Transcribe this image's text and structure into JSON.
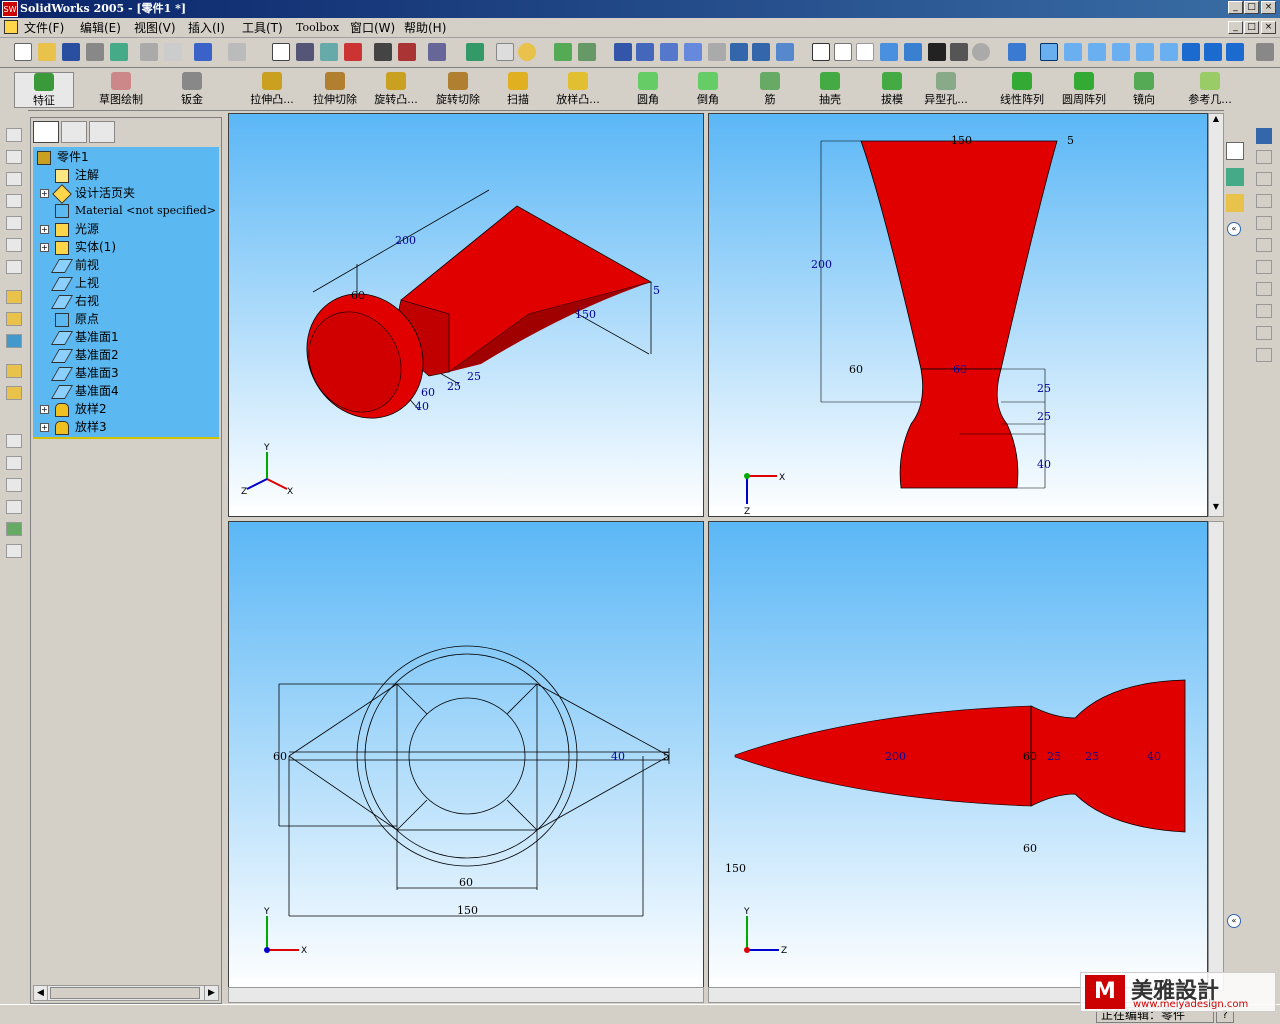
{
  "title": "SolidWorks 2005 - [零件1 *]",
  "app_icon_text": "SW",
  "menu": [
    "文件(F)",
    "编辑(E)",
    "视图(V)",
    "插入(I)",
    "工具(T)",
    "Toolbox",
    "窗口(W)",
    "帮助(H)"
  ],
  "features": [
    "特征",
    "草图绘制",
    "钣金",
    "拉伸凸...",
    "拉伸切除",
    "旋转凸...",
    "旋转切除",
    "扫描",
    "放样凸...",
    "圆角",
    "倒角",
    "筋",
    "抽壳",
    "拔模",
    "异型孔...",
    "线性阵列",
    "圆周阵列",
    "镜向",
    "参考几..."
  ],
  "tree": {
    "root": "零件1",
    "items": [
      "注解",
      "设计活页夹",
      "Material <not specified>",
      "光源",
      "实体(1)",
      "前视",
      "上视",
      "右视",
      "原点",
      "基准面1",
      "基准面2",
      "基准面3",
      "基准面4",
      "放样2",
      "放样3"
    ]
  },
  "dims": {
    "iso": {
      "d200": "200",
      "d60": "60",
      "d150": "150",
      "d5": "5",
      "d25a": "25",
      "d25b": "25",
      "d60b": "60",
      "d40": "40"
    },
    "front": {
      "d150": "150",
      "d5": "5",
      "d200": "200",
      "d60a": "60",
      "d60b": "60",
      "d25a": "25",
      "d25b": "25",
      "d40": "40"
    },
    "top": {
      "d60": "60",
      "d40": "40",
      "d5": "5",
      "d60b": "60",
      "d150": "150"
    },
    "right": {
      "d200": "200",
      "d60": "60",
      "d25a": "25",
      "d25b": "25",
      "d40": "40",
      "d60b": "60",
      "d150": "150"
    }
  },
  "axes": {
    "x": "X",
    "y": "Y",
    "z": "Z"
  },
  "status_text": "正在编辑：零件",
  "help_glyph": "?",
  "watermark": {
    "name": "美雅設計",
    "url": "www.meiyadesign.com"
  },
  "colors": {
    "part": "#e00000",
    "viewport_top": "#5bb7f6",
    "tree_bg": "#5cb8f0",
    "titlebar": "#0a246a"
  }
}
